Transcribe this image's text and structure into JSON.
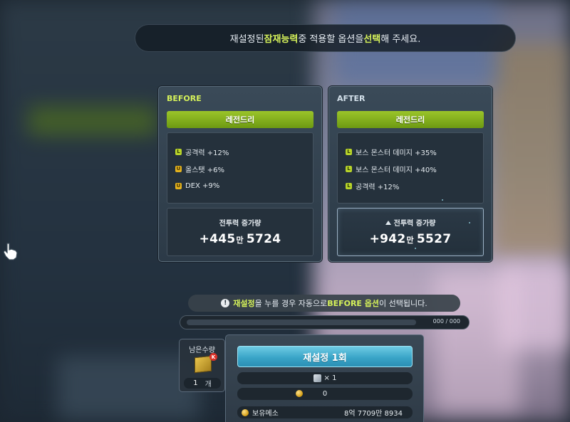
{
  "banner": {
    "part1": "재설정된 ",
    "highlight1": "잠재능력",
    "part2": " 중 적용할 옵션을 ",
    "highlight2": "선택",
    "part3": "해 주세요."
  },
  "before": {
    "title": "BEFORE",
    "grade": "레전드리",
    "options": [
      {
        "tier": "L",
        "text": "공격력 +12%"
      },
      {
        "tier": "U",
        "text": "올스탯 +6%"
      },
      {
        "tier": "U",
        "text": "DEX +9%"
      }
    ],
    "power_label": "전투력 증가량",
    "power_prefix": "+445",
    "power_unit": "만",
    "power_rest": "5724"
  },
  "after": {
    "title": "AFTER",
    "grade": "레전드리",
    "options": [
      {
        "tier": "L",
        "text": "보스 몬스터 데미지 +35%"
      },
      {
        "tier": "L",
        "text": "보스 몬스터 데미지 +40%"
      },
      {
        "tier": "L",
        "text": "공격력 +12%"
      }
    ],
    "power_label": "전투력 증가량",
    "power_prefix": "+942",
    "power_unit": "만",
    "power_rest": "5527"
  },
  "notice": {
    "highlight1": "재설정",
    "part1": "을 누를 경우 자동으로 ",
    "highlight2": "BEFORE 옵션",
    "part2": "이 선택됩니다."
  },
  "progress": {
    "text": "000 / 000",
    "fill_fraction": 0
  },
  "remaining": {
    "label": "남은수량",
    "count": "1",
    "unit": "개"
  },
  "reset": {
    "button_label": "재설정 1회",
    "cube_cost": "× 1",
    "meso_cost": "0",
    "held_meso_label": "보유메소",
    "held_meso_value": "8억 7709만 8934"
  },
  "colors": {
    "highlight": "#d6f25a",
    "grade_legendary": "#8cbb1f",
    "reset_button": "#3aa5c8"
  }
}
